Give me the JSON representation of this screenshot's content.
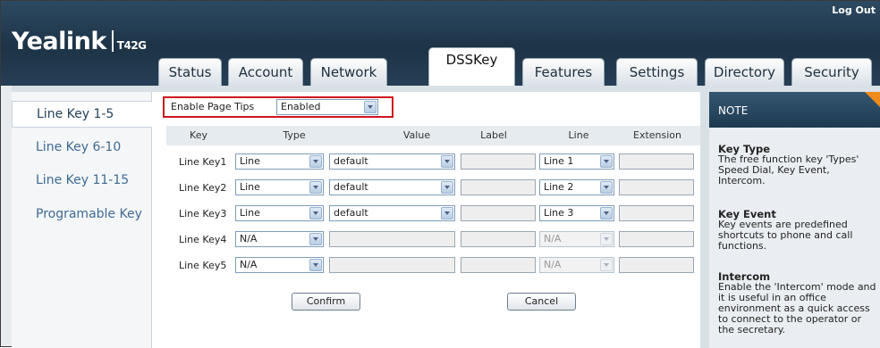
{
  "header": {
    "logout": "Log Out",
    "brand": "Yealink",
    "model": "T42G"
  },
  "tabs": [
    "Status",
    "Account",
    "Network",
    "DSSKey",
    "Features",
    "Settings",
    "Directory",
    "Security"
  ],
  "active_tab": "DSSKey",
  "sidebar": {
    "items": [
      "Line Key 1-5",
      "Line Key 6-10",
      "Line Key 11-15",
      "Programable Key"
    ],
    "active": "Line Key 1-5"
  },
  "page_tips": {
    "label": "Enable Page Tips",
    "value": "Enabled"
  },
  "table": {
    "headers": [
      "Key",
      "Type",
      "Value",
      "Label",
      "Line",
      "Extension"
    ],
    "rows": [
      {
        "key": "Line Key1",
        "type": "Line",
        "value": "default",
        "label": "",
        "line": "Line 1",
        "extension": "",
        "disabled": false
      },
      {
        "key": "Line Key2",
        "type": "Line",
        "value": "default",
        "label": "",
        "line": "Line 2",
        "extension": "",
        "disabled": false
      },
      {
        "key": "Line Key3",
        "type": "Line",
        "value": "default",
        "label": "",
        "line": "Line 3",
        "extension": "",
        "disabled": false
      },
      {
        "key": "Line Key4",
        "type": "N/A",
        "value": "",
        "label": "",
        "line": "N/A",
        "extension": "",
        "disabled": true
      },
      {
        "key": "Line Key5",
        "type": "N/A",
        "value": "",
        "label": "",
        "line": "N/A",
        "extension": "",
        "disabled": true
      }
    ]
  },
  "buttons": {
    "confirm": "Confirm",
    "cancel": "Cancel"
  },
  "note": {
    "title": "NOTE",
    "sections": [
      {
        "title": "Key Type",
        "text": "The free function key 'Types' Speed Dial, Key Event, Intercom."
      },
      {
        "title": "Key Event",
        "text": "Key events are predefined shortcuts to phone and call functions."
      },
      {
        "title": "Intercom",
        "text": "Enable the 'Intercom' mode and it is useful in an office environment as a quick access to connect to the operator or the secretary."
      }
    ]
  },
  "colors": {
    "header": "#1d3346",
    "highlight_border": "#d0161e",
    "note_flag": "#f08a1d",
    "sidebar_link": "#3f6b93"
  }
}
